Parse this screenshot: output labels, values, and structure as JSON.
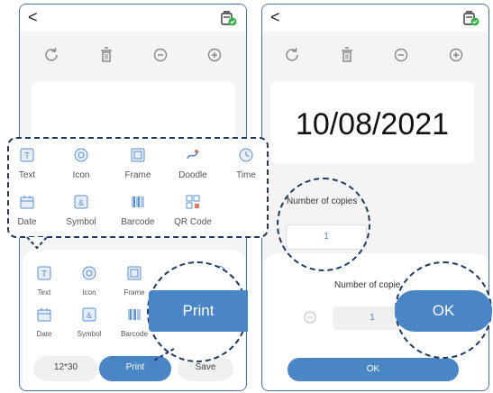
{
  "left": {
    "back_glyph": "<",
    "popup_items": [
      {
        "label": "Text",
        "icon": "text-icon"
      },
      {
        "label": "Icon",
        "icon": "emoji-icon"
      },
      {
        "label": "Frame",
        "icon": "frame-icon"
      },
      {
        "label": "Doodle",
        "icon": "doodle-icon"
      },
      {
        "label": "Time",
        "icon": "clock-icon"
      },
      {
        "label": "Date",
        "icon": "calendar-icon"
      },
      {
        "label": "Symbol",
        "icon": "symbol-icon"
      },
      {
        "label": "Barcode",
        "icon": "barcode-icon"
      },
      {
        "label": "QR Code",
        "icon": "qrcode-icon"
      }
    ],
    "sheet_items": [
      {
        "label": "Text"
      },
      {
        "label": "Icon"
      },
      {
        "label": "Frame"
      },
      {
        "label": "Date"
      },
      {
        "label": "Symbol"
      },
      {
        "label": "Barcode"
      }
    ],
    "size_label": "12*30",
    "print_label": "Print",
    "save_label": "Save",
    "zoom_print_label": "Print"
  },
  "right": {
    "back_glyph": "<",
    "canvas_text": "10/08/2021",
    "copies_label": "Number of copies",
    "copies_value": "1",
    "sheet_copies_label": "Number of copie",
    "sheet_copies_value": "1",
    "ok_label": "OK",
    "zoom_ok_label": "OK"
  },
  "colors": {
    "accent": "#4a86c5",
    "dash": "#1f3a63",
    "icon_blue": "#5b8fd1",
    "printer_green": "#34b24a"
  }
}
